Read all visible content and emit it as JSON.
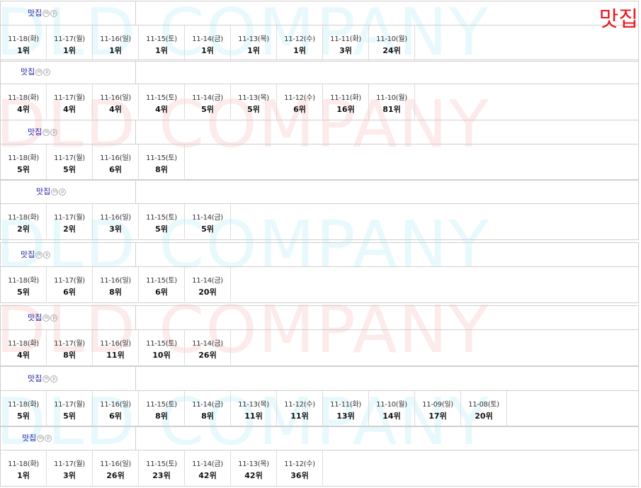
{
  "page_label": "맛집",
  "watermark": {
    "text": "DLD COMPANY",
    "colors": [
      "#e7f9fd",
      "#fdeaea"
    ]
  },
  "blocks": [
    {
      "keyword": "맛집",
      "badges": [
        "m",
        "p"
      ],
      "ranks": [
        {
          "date": "11-18(화)",
          "rank": "1위"
        },
        {
          "date": "11-17(월)",
          "rank": "1위"
        },
        {
          "date": "11-16(일)",
          "rank": "1위"
        },
        {
          "date": "11-15(토)",
          "rank": "1위"
        },
        {
          "date": "11-14(금)",
          "rank": "1위"
        },
        {
          "date": "11-13(목)",
          "rank": "1위"
        },
        {
          "date": "11-12(수)",
          "rank": "1위"
        },
        {
          "date": "11-11(화)",
          "rank": "3위"
        },
        {
          "date": "11-10(월)",
          "rank": "24위"
        }
      ]
    },
    {
      "keyword": "맛집",
      "badges": [
        "m",
        "p"
      ],
      "ranks": [
        {
          "date": "11-18(화)",
          "rank": "4위"
        },
        {
          "date": "11-17(월)",
          "rank": "4위"
        },
        {
          "date": "11-16(일)",
          "rank": "4위"
        },
        {
          "date": "11-15(토)",
          "rank": "4위"
        },
        {
          "date": "11-14(금)",
          "rank": "5위"
        },
        {
          "date": "11-13(목)",
          "rank": "5위"
        },
        {
          "date": "11-12(수)",
          "rank": "6위"
        },
        {
          "date": "11-11(화)",
          "rank": "16위"
        },
        {
          "date": "11-10(월)",
          "rank": "81위"
        }
      ]
    },
    {
      "keyword": "맛집",
      "badges": [
        "m",
        "p"
      ],
      "ranks": [
        {
          "date": "11-18(화)",
          "rank": "5위"
        },
        {
          "date": "11-17(월)",
          "rank": "5위"
        },
        {
          "date": "11-16(일)",
          "rank": "6위"
        },
        {
          "date": "11-15(토)",
          "rank": "8위"
        }
      ]
    },
    {
      "keyword": "맛집",
      "badges": [
        "m",
        "p"
      ],
      "ranks": [
        {
          "date": "11-18(화)",
          "rank": "2위"
        },
        {
          "date": "11-17(월)",
          "rank": "2위"
        },
        {
          "date": "11-16(일)",
          "rank": "3위"
        },
        {
          "date": "11-15(토)",
          "rank": "5위"
        },
        {
          "date": "11-14(금)",
          "rank": "5위"
        }
      ]
    },
    {
      "keyword": "맛집",
      "badges": [
        "m",
        "p"
      ],
      "ranks": [
        {
          "date": "11-18(화)",
          "rank": "5위"
        },
        {
          "date": "11-17(월)",
          "rank": "6위"
        },
        {
          "date": "11-16(일)",
          "rank": "8위"
        },
        {
          "date": "11-15(토)",
          "rank": "6위"
        },
        {
          "date": "11-14(금)",
          "rank": "20위"
        }
      ]
    },
    {
      "keyword": "맛집",
      "badges": [
        "m",
        "p"
      ],
      "ranks": [
        {
          "date": "11-18(화)",
          "rank": "4위"
        },
        {
          "date": "11-17(월)",
          "rank": "8위"
        },
        {
          "date": "11-16(일)",
          "rank": "11위"
        },
        {
          "date": "11-15(토)",
          "rank": "10위"
        },
        {
          "date": "11-14(금)",
          "rank": "26위"
        }
      ]
    },
    {
      "keyword": "맛집",
      "badges": [
        "m",
        "p"
      ],
      "ranks": [
        {
          "date": "11-18(화)",
          "rank": "5위"
        },
        {
          "date": "11-17(월)",
          "rank": "5위"
        },
        {
          "date": "11-16(일)",
          "rank": "6위"
        },
        {
          "date": "11-15(토)",
          "rank": "8위"
        },
        {
          "date": "11-14(금)",
          "rank": "8위"
        },
        {
          "date": "11-13(목)",
          "rank": "11위"
        },
        {
          "date": "11-12(수)",
          "rank": "11위"
        },
        {
          "date": "11-11(화)",
          "rank": "13위"
        },
        {
          "date": "11-10(월)",
          "rank": "14위"
        },
        {
          "date": "11-09(일)",
          "rank": "17위"
        },
        {
          "date": "11-08(토)",
          "rank": "20위"
        }
      ]
    },
    {
      "keyword": "맛집",
      "badges": [
        "m",
        "p"
      ],
      "ranks": [
        {
          "date": "11-18(화)",
          "rank": "1위"
        },
        {
          "date": "11-17(월)",
          "rank": "3위"
        },
        {
          "date": "11-16(일)",
          "rank": "26위"
        },
        {
          "date": "11-15(토)",
          "rank": "23위"
        },
        {
          "date": "11-14(금)",
          "rank": "42위"
        },
        {
          "date": "11-13(목)",
          "rank": "42위"
        },
        {
          "date": "11-12(수)",
          "rank": "36위"
        }
      ]
    }
  ]
}
